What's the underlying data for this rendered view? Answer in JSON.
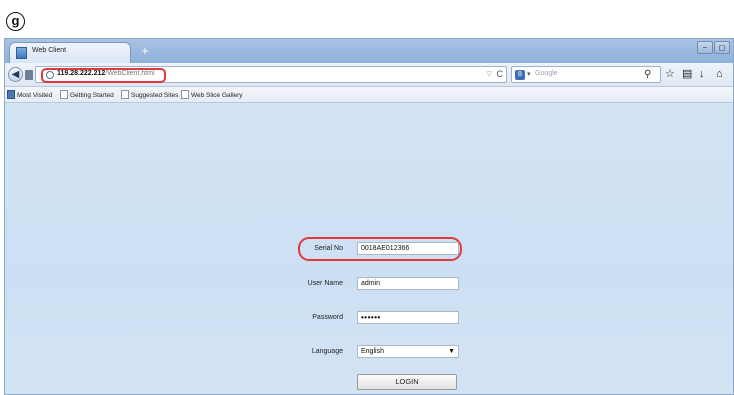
{
  "figure_label": "g",
  "browser": {
    "tab_title": "Web Client",
    "new_tab_symbol": "+",
    "window_buttons": [
      "−",
      "◻"
    ],
    "url_host": "119.28.222.212",
    "url_path": "/WebClient.html",
    "search_placeholder": "Google",
    "icons": [
      "back-arrow-icon",
      "star-icon",
      "clipboard-icon",
      "download-icon",
      "home-icon",
      "search-icon",
      "reload-icon"
    ]
  },
  "bookmarks": [
    {
      "label": "Most Visited"
    },
    {
      "label": "Getting Started"
    },
    {
      "label": "Suggested Sites"
    },
    {
      "label": "Web Slice Gallery"
    }
  ],
  "login_form": {
    "serial_label": "Serial No",
    "serial_value": "0018AE012366",
    "username_label": "User Name",
    "username_value": "admin",
    "password_label": "Password",
    "password_value": "••••••",
    "language_label": "Language",
    "language_value": "English",
    "login_label": "LOGIN"
  },
  "colors": {
    "highlight": "#e03a3e",
    "page_background": "#cfe1f3"
  }
}
